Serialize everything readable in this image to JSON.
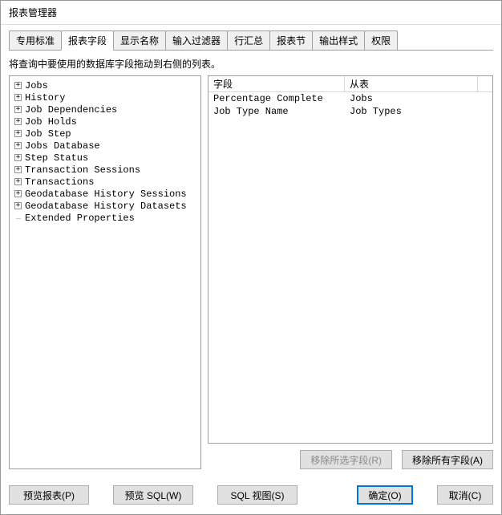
{
  "window": {
    "title": "报表管理器"
  },
  "tabs": [
    {
      "label": "专用标准",
      "active": false
    },
    {
      "label": "报表字段",
      "active": true
    },
    {
      "label": "显示名称",
      "active": false
    },
    {
      "label": "输入过滤器",
      "active": false
    },
    {
      "label": "行汇总",
      "active": false
    },
    {
      "label": "报表节",
      "active": false
    },
    {
      "label": "输出样式",
      "active": false
    },
    {
      "label": "权限",
      "active": false
    }
  ],
  "instruction": "将查询中要使用的数据库字段拖动到右侧的列表。",
  "tree": [
    {
      "label": "Jobs",
      "expandable": true
    },
    {
      "label": "History",
      "expandable": true
    },
    {
      "label": "Job Dependencies",
      "expandable": true
    },
    {
      "label": "Job Holds",
      "expandable": true
    },
    {
      "label": "Job Step",
      "expandable": true
    },
    {
      "label": "Jobs Database",
      "expandable": true
    },
    {
      "label": "Step Status",
      "expandable": true
    },
    {
      "label": "Transaction Sessions",
      "expandable": true
    },
    {
      "label": "Transactions",
      "expandable": true
    },
    {
      "label": "Geodatabase History Sessions",
      "expandable": true
    },
    {
      "label": "Geodatabase History Datasets",
      "expandable": true
    },
    {
      "label": "Extended Properties",
      "expandable": false
    }
  ],
  "list": {
    "headers": {
      "field": "字段",
      "from": "从表"
    },
    "rows": [
      {
        "field": "Percentage Complete",
        "from": "Jobs"
      },
      {
        "field": "Job Type Name",
        "from": "Job Types"
      }
    ]
  },
  "buttons": {
    "remove_selected": "移除所选字段(R)",
    "remove_all": "移除所有字段(A)",
    "preview_report": "预览报表(P)",
    "preview_sql": "预览 SQL(W)",
    "sql_view": "SQL 视图(S)",
    "ok": "确定(O)",
    "cancel": "取消(C)"
  }
}
